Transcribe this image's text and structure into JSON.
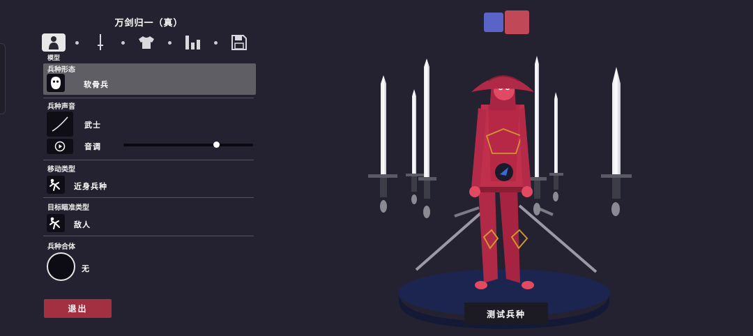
{
  "unit_title": "万剑归一（真）",
  "toolbar": {
    "tabs": [
      {
        "icon": "person-icon",
        "active": true
      },
      {
        "icon": "sword-icon",
        "active": false
      },
      {
        "icon": "shirt-icon",
        "active": false
      },
      {
        "icon": "stats-icon",
        "active": false
      },
      {
        "icon": "save-icon",
        "active": false
      }
    ],
    "active_label": "模型"
  },
  "sections": {
    "form": {
      "label": "兵种形态",
      "value": "软骨兵",
      "icon": "mask-icon"
    },
    "voice": {
      "label": "兵种声音",
      "value": "武士",
      "icon": "curve-icon",
      "pitch_label": "音调",
      "pitch_level": 0.72,
      "pitch_icon": "play-icon"
    },
    "movement": {
      "label": "移动类型",
      "value": "近身兵种",
      "icon": "running-unit-icon"
    },
    "targeting": {
      "label": "目标瞄准类型",
      "value": "敌人",
      "icon": "running-unit-icon"
    },
    "combine": {
      "label": "兵种合体",
      "value": "无"
    }
  },
  "exit_label": "退出",
  "test_label": "测试兵种",
  "team_colors": {
    "blue": "#5a63c6",
    "red": "#c04857"
  },
  "colors": {
    "accent_red": "#a23040",
    "unit_red": "#b02a48",
    "background": "#242230"
  }
}
